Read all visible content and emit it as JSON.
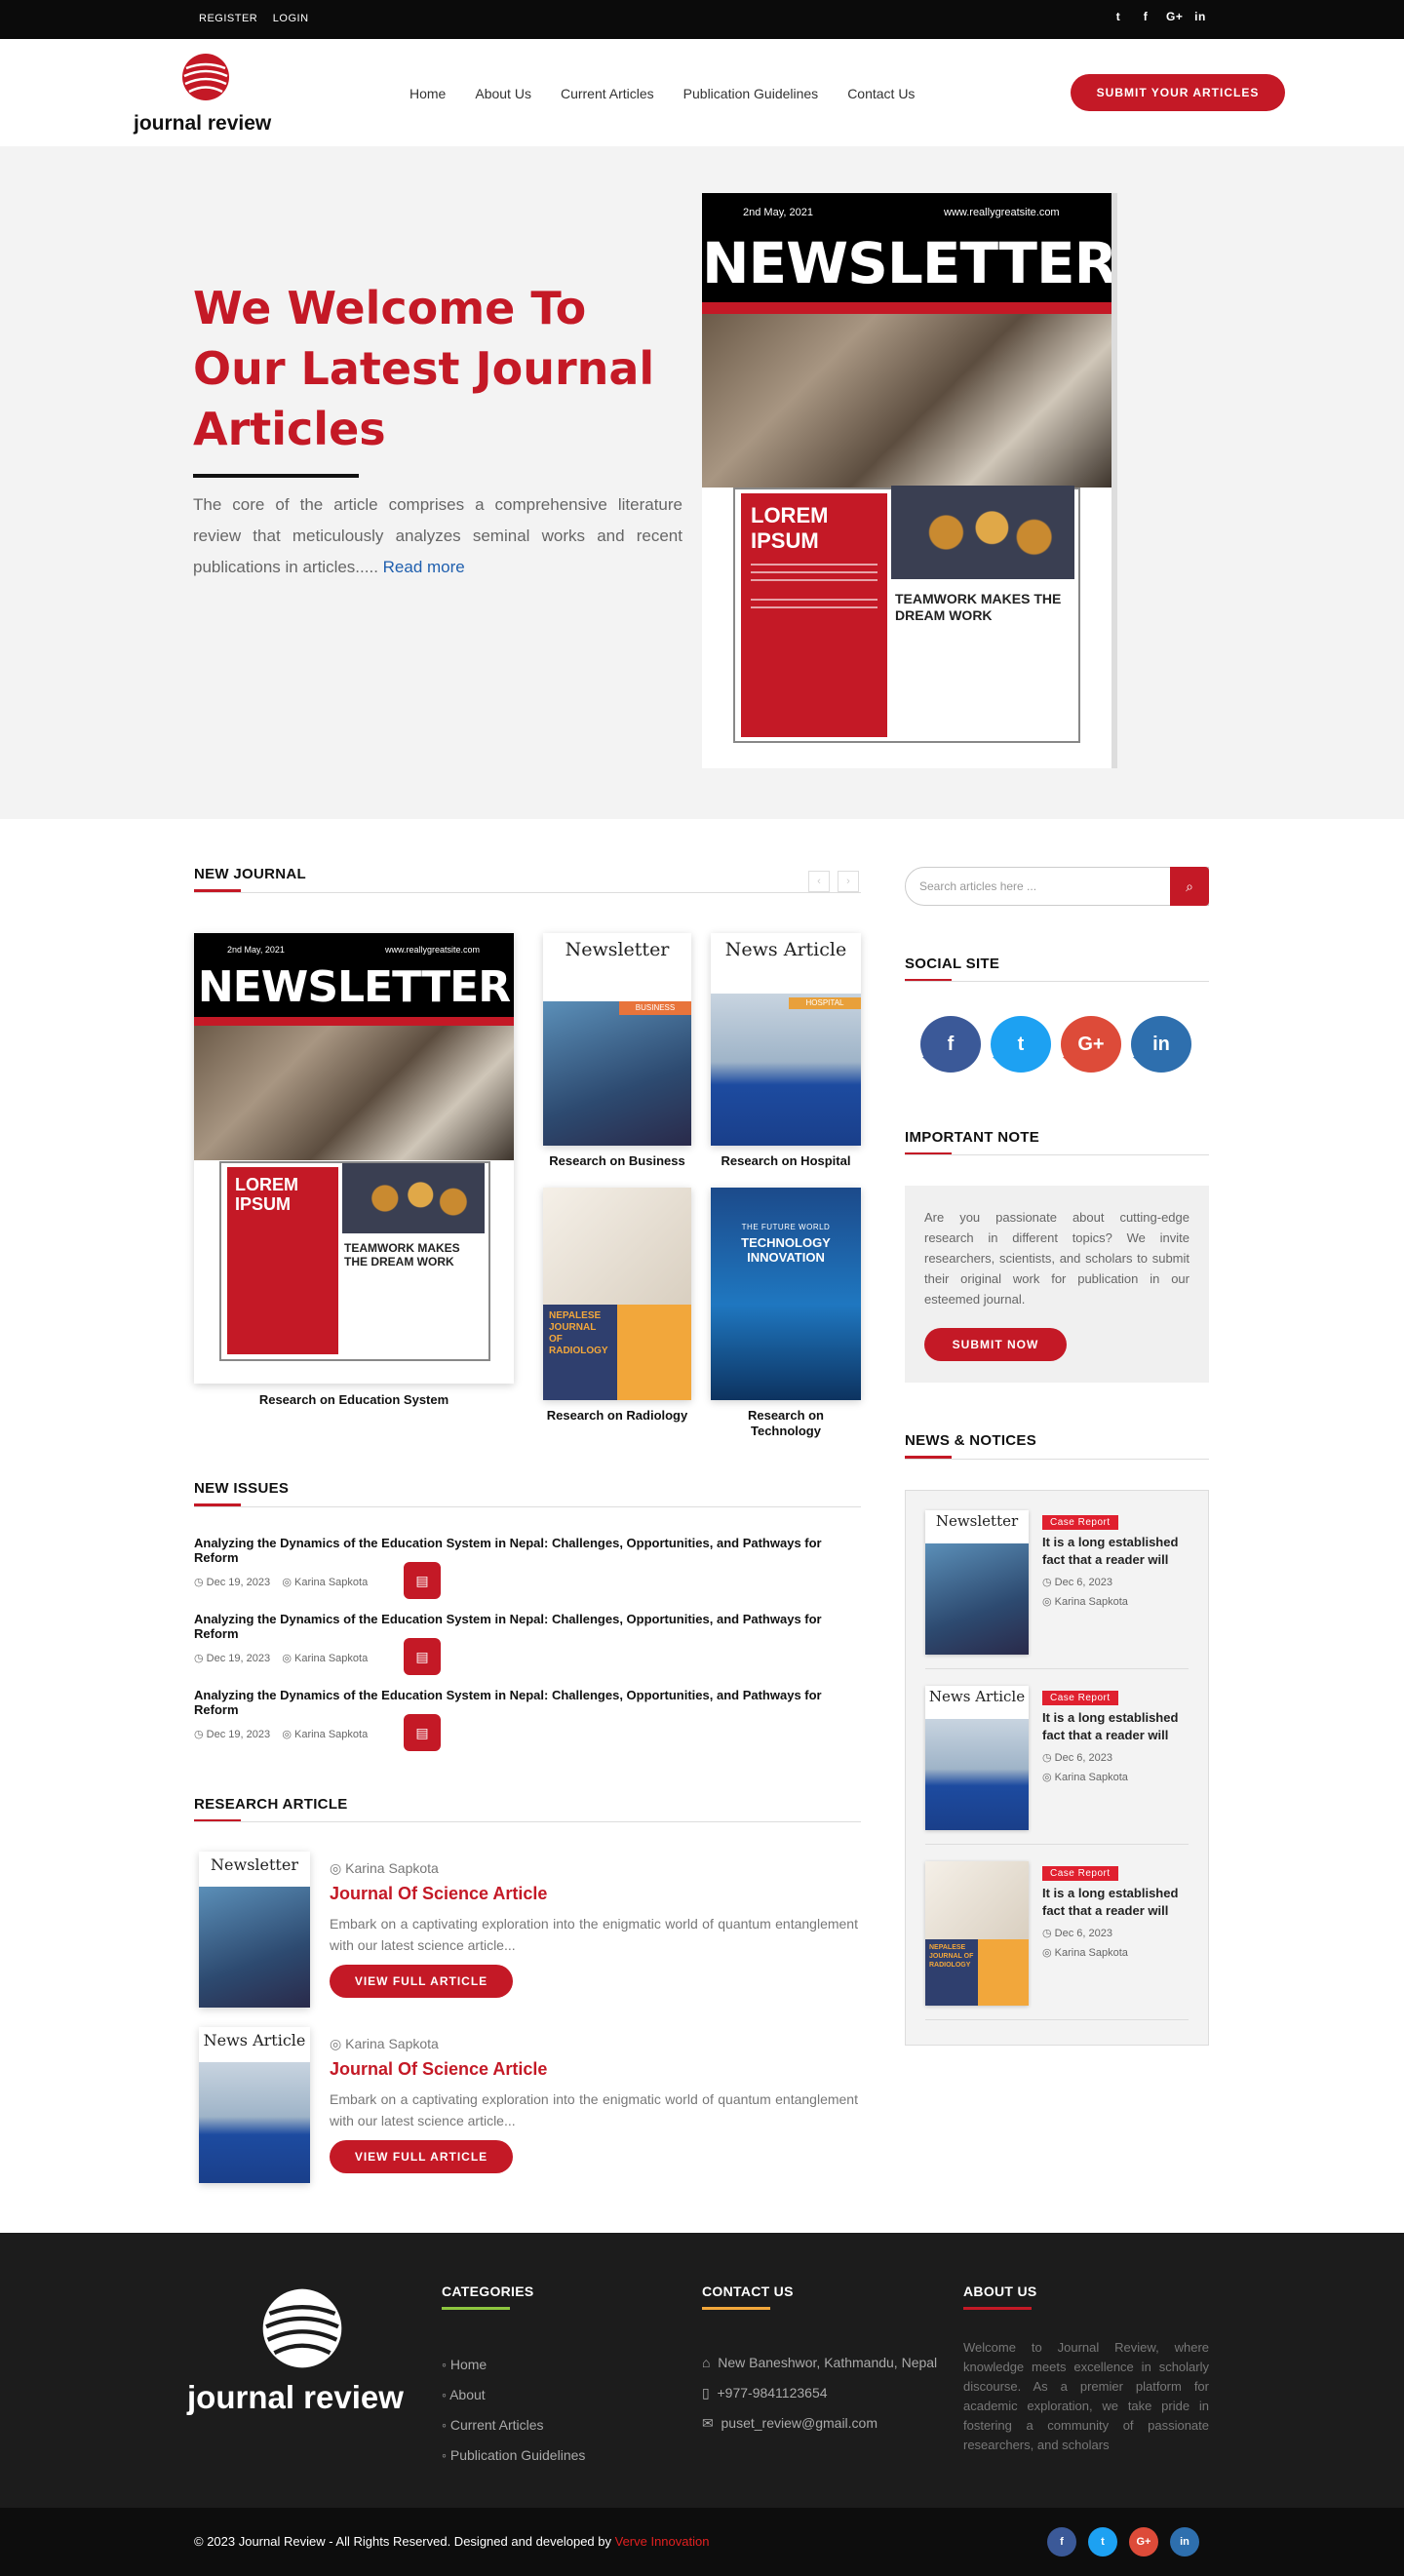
{
  "topbar": {
    "register": "REGISTER",
    "login": "LOGIN",
    "social": [
      "t",
      "f",
      "G+",
      "in"
    ]
  },
  "header": {
    "logo": "journal review",
    "nav": [
      "Home",
      "About Us",
      "Current Articles",
      "Publication Guidelines",
      "Contact Us"
    ],
    "submit": "SUBMIT YOUR ARTICLES"
  },
  "hero": {
    "title": "We Welcome To Our Latest Journal Articles",
    "text": "The core of the article comprises a comprehensive literature review that meticulously analyzes seminal works and recent publications in articles.....",
    "read_more": "Read more",
    "newsletter": {
      "date": "2nd May, 2021",
      "site": "www.reallygreatsite.com",
      "title": "NEWSLETTER",
      "lorem": "LOREM IPSUM",
      "teamwork": "TEAMWORK MAKES THE DREAM WORK"
    }
  },
  "new_journal": {
    "title": "NEW JOURNAL",
    "items": [
      "Research on Education System",
      "Research on Business",
      "Research on Hospital",
      "Research on Radiology",
      "Research on Technology"
    ],
    "thumb_labels": {
      "newsletter": "Newsletter",
      "news_article": "News Article",
      "radiology": "NEPALESE JOURNAL OF RADIOLOGY",
      "tech_top": "THE FUTURE WORLD",
      "tech": "TECHNOLOGY INNOVATION",
      "business": "BUSINESS",
      "hospital": "HOSPITAL"
    }
  },
  "sidebar": {
    "search_placeholder": "Search articles here ...",
    "social_title": "SOCIAL SITE",
    "social": [
      "f",
      "t",
      "G+",
      "in"
    ],
    "note_title": "IMPORTANT NOTE",
    "note_text": "Are you passionate about cutting-edge research in different topics? We invite researchers, scientists, and scholars to submit their original work for publication in our esteemed journal.",
    "note_button": "SUBMIT NOW",
    "news_title": "NEWS & NOTICES",
    "news": [
      {
        "badge": "Case Report",
        "title": "It is a long established fact that a reader will",
        "date": "Dec 6, 2023",
        "author": "Karina Sapkota"
      },
      {
        "badge": "Case Report",
        "title": "It is a long established fact that a reader will",
        "date": "Dec 6, 2023",
        "author": "Karina Sapkota"
      },
      {
        "badge": "Case Report",
        "title": "It is a long established fact that a reader will",
        "date": "Dec 6, 2023",
        "author": "Karina Sapkota"
      }
    ]
  },
  "issues": {
    "title": "NEW ISSUES",
    "items": [
      {
        "title": "Analyzing the Dynamics of the Education System in Nepal: Challenges, Opportunities, and Pathways for Reform",
        "date": "Dec 19, 2023",
        "author": "Karina Sapkota"
      },
      {
        "title": "Analyzing the Dynamics of the Education System in Nepal: Challenges, Opportunities, and Pathways for Reform",
        "date": "Dec 19, 2023",
        "author": "Karina Sapkota"
      },
      {
        "title": "Analyzing the Dynamics of the Education System in Nepal: Challenges, Opportunities, and Pathways for Reform",
        "date": "Dec 19, 2023",
        "author": "Karina Sapkota"
      }
    ]
  },
  "research": {
    "title": "RESEARCH ARTICLE",
    "items": [
      {
        "author": "Karina Sapkota",
        "title": "Journal Of Science Article",
        "desc": "Embark on a captivating exploration into the enigmatic world of quantum entanglement with our latest science article...",
        "button": "VIEW FULL ARTICLE"
      },
      {
        "author": "Karina Sapkota",
        "title": "Journal Of Science Article",
        "desc": "Embark on a captivating exploration into the enigmatic world of quantum entanglement with our latest science article...",
        "button": "VIEW FULL ARTICLE"
      }
    ]
  },
  "footer": {
    "logo": "journal review",
    "categories_title": "CATEGORIES",
    "categories": [
      "Home",
      "About",
      "Current Articles",
      "Publication Guidelines"
    ],
    "contact_title": "CONTACT US",
    "address": "New Baneshwor, Kathmandu, Nepal",
    "phone": "+977-9841123654",
    "email": "puset_review@gmail.com",
    "about_title": "ABOUT US",
    "about": "Welcome to Journal Review, where knowledge meets excellence in scholarly discourse. As a premier platform for academic exploration, we take pride in fostering a community of passionate researchers, and scholars",
    "copyright": "© 2023 Journal Review - All Rights Reserved. Designed and developed by ",
    "developer": "Verve Innovation",
    "social": [
      "f",
      "t",
      "G+",
      "in"
    ]
  },
  "colors": {
    "accent": "#c41926",
    "facebook": "#3b5998",
    "twitter": "#1da1f2",
    "google": "#dd4b39",
    "linkedin": "#2e6fae"
  }
}
